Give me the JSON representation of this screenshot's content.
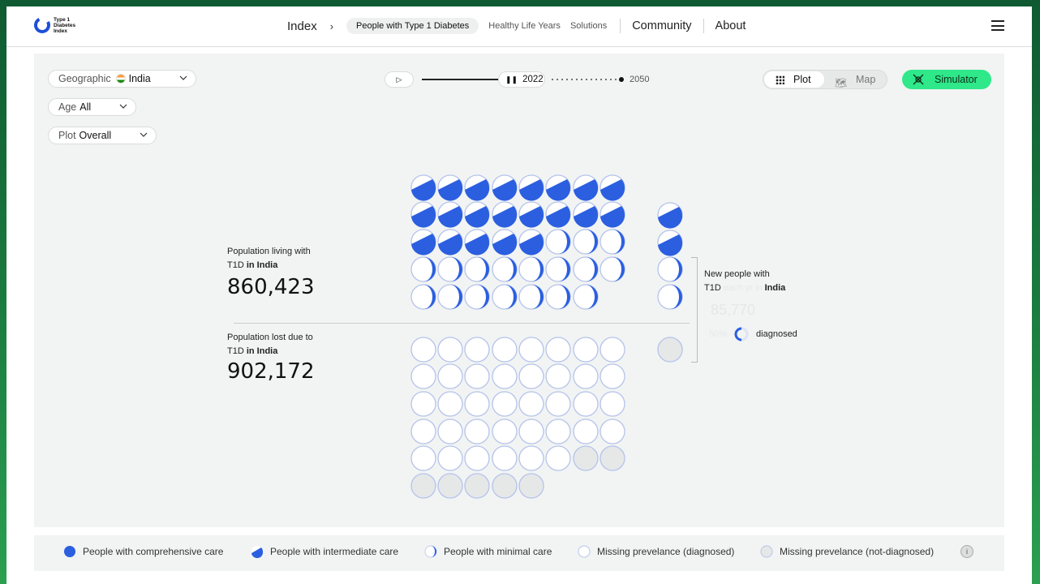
{
  "header": {
    "logo_lines": [
      "Type 1",
      "Diabetes",
      "Index"
    ],
    "nav": {
      "index": "Index",
      "chevron": "›",
      "active": "People with Type 1 Diabetes",
      "link1": "Healthy Life Years",
      "link2": "Solutions",
      "community": "Community",
      "about": "About"
    }
  },
  "filters": {
    "geographic": {
      "label": "Geographic",
      "value": "India"
    },
    "age": {
      "label": "Age",
      "value": "All"
    },
    "plot": {
      "label": "Plot",
      "value": "Overall"
    }
  },
  "timeline": {
    "current_year": "2022",
    "end_year": "2050",
    "progress": 0.39
  },
  "view_toggle": {
    "plot": "Plot",
    "map": "Map",
    "active": "Plot"
  },
  "simulator_label": "Simulator",
  "stats": {
    "living": {
      "label_line1": "Population living with",
      "label_prefix": "T1D",
      "label_in": "in India",
      "value": "860,423"
    },
    "lost": {
      "label_line1": "Population lost due to",
      "label_prefix": "T1D",
      "label_in": "in India",
      "value": "902,172"
    },
    "new": {
      "label_line1": "New people with",
      "label_prefix": "T1D",
      "label_faded": "each yr in",
      "label_country": "India",
      "value_faded": "85,770",
      "faded_prefix": "50%",
      "diagnosed": "diagnosed"
    }
  },
  "colors": {
    "comprehensive": "#2b5fe0",
    "outline": "#b6c3ea",
    "missing_bg": "#e6e8e8",
    "accent_green": "#2ee88a"
  },
  "legend": {
    "comprehensive": "People with comprehensive care",
    "intermediate": "People with intermediate care",
    "minimal": "People with minimal care",
    "missing_diagnosed": "Missing prevelance (diagnosed)",
    "missing_not_diagnosed": "Missing prevelance (not-diagnosed)",
    "info": "i"
  }
}
